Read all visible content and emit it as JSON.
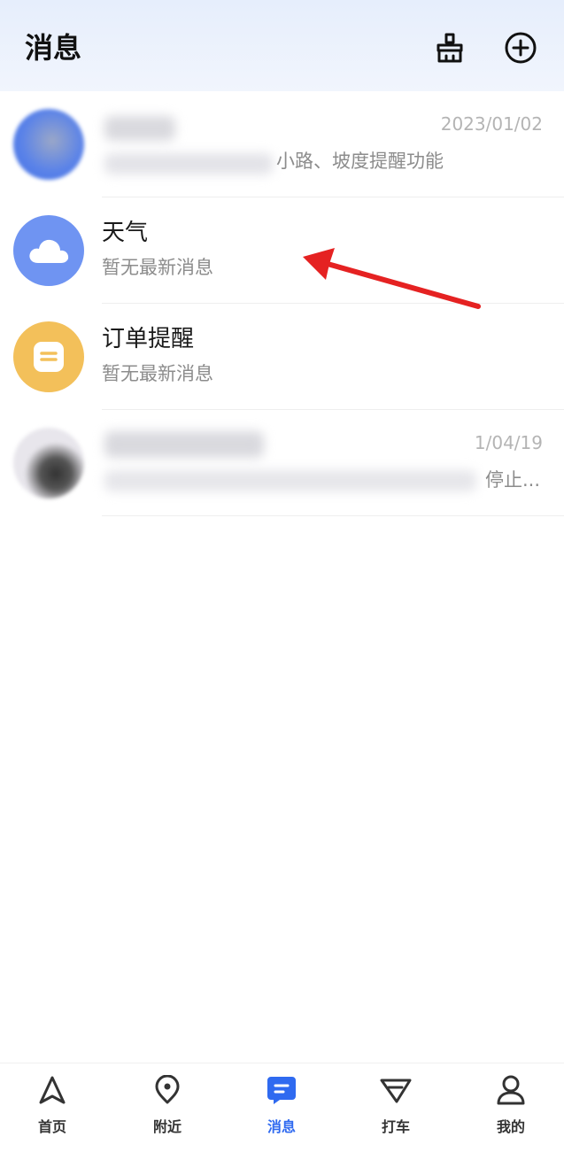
{
  "header": {
    "title": "消息",
    "broom_icon": "broom-icon",
    "add_icon": "plus-circle-icon"
  },
  "messages": [
    {
      "title": "",
      "subtitle": "小路、坡度提醒功能",
      "time": "2023/01/02",
      "avatar_color": "#5b83e8",
      "blurred": true
    },
    {
      "title": "天气",
      "subtitle": "暂无最新消息",
      "time": "",
      "avatar_color": "#6f94f2",
      "icon": "cloud-icon"
    },
    {
      "title": "订单提醒",
      "subtitle": "暂无最新消息",
      "time": "",
      "avatar_color": "#f3c05a",
      "icon": "order-note-icon"
    },
    {
      "title": "",
      "subtitle": "停止...",
      "time": "1/04/19",
      "avatar_color": "#e8e6ec",
      "blurred": true
    }
  ],
  "annotation": {
    "color": "#e52222"
  },
  "tabbar": {
    "active_color": "#2f6af0",
    "tabs": [
      {
        "label": "首页",
        "icon": "navigate-arrow-icon"
      },
      {
        "label": "附近",
        "icon": "location-pin-icon"
      },
      {
        "label": "消息",
        "icon": "message-icon",
        "active": true
      },
      {
        "label": "打车",
        "icon": "ride-icon"
      },
      {
        "label": "我的",
        "icon": "user-icon"
      }
    ]
  }
}
